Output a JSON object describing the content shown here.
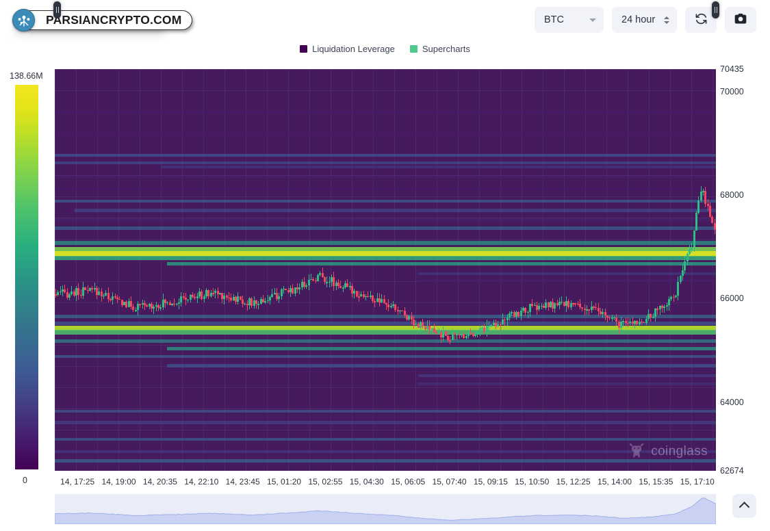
{
  "brand": {
    "name": "PARSIANCRYPTO.COM",
    "logo_icon": "parsian-crypto-logo-icon"
  },
  "toolbar": {
    "symbol_value": "BTC",
    "symbol_caret_icon": "chevron-down-icon",
    "range_value": "24 hour",
    "range_stepper_icon": "stepper-up-down-icon",
    "refresh_icon": "refresh-icon",
    "camera_icon": "camera-icon"
  },
  "legend": {
    "items": [
      {
        "label": "Liquidation Leverage",
        "color": "#440154"
      },
      {
        "label": "Supercharts",
        "color": "#4ec98b"
      }
    ]
  },
  "colorbar": {
    "max_label": "138.66M",
    "min_label": "0",
    "scheme": "viridis",
    "low_color": "#440154",
    "high_color": "#f2e620"
  },
  "watermark": {
    "text": "coinglass",
    "icon": "coinglass-bull-icon"
  },
  "navigator": {
    "left_handle_icon": "drag-handle-icon",
    "right_handle_icon": "drag-handle-icon",
    "area_color": "#c9d2f2"
  },
  "scroll_top": {
    "icon": "chevron-up-icon"
  },
  "chart_data": {
    "type": "heatmap",
    "title": "",
    "xlabel": "",
    "ylabel": "",
    "legend_position": "top-center",
    "grid": true,
    "ylim": [
      62674,
      70435
    ],
    "y_ticks": [
      "70435",
      "70000",
      "68000",
      "66000",
      "64000",
      "62674"
    ],
    "y_tick_values": [
      70435,
      70000,
      68000,
      66000,
      64000,
      62674
    ],
    "x_ticks": [
      "14, 17:25",
      "14, 19:00",
      "14, 20:35",
      "14, 22:10",
      "14, 23:45",
      "15, 01:20",
      "15, 02:55",
      "15, 04:30",
      "15, 06:05",
      "15, 07:40",
      "15, 09:15",
      "15, 10:50",
      "15, 12:25",
      "15, 14:00",
      "15, 15:35",
      "15, 17:10"
    ],
    "colorbar_range": [
      0,
      138660000
    ],
    "colorbar_max_label": "138.66M",
    "series": [
      {
        "name": "Liquidation Leverage",
        "color": "#440154"
      },
      {
        "name": "Supercharts",
        "color": "#4ec98b"
      }
    ],
    "liquidation_bands": [
      {
        "price": 69600,
        "x_start": 0.0,
        "x_end": 1.0,
        "intensity": 0.1
      },
      {
        "price": 69180,
        "x_start": 0.0,
        "x_end": 1.0,
        "intensity": 0.09
      },
      {
        "price": 68760,
        "x_start": 0.0,
        "x_end": 1.0,
        "intensity": 0.3
      },
      {
        "price": 68620,
        "x_start": 0.0,
        "x_end": 1.0,
        "intensity": 0.27
      },
      {
        "price": 68540,
        "x_start": 0.16,
        "x_end": 1.0,
        "intensity": 0.2
      },
      {
        "price": 68340,
        "x_start": 0.0,
        "x_end": 1.0,
        "intensity": 0.12
      },
      {
        "price": 68120,
        "x_start": 0.0,
        "x_end": 1.0,
        "intensity": 0.1
      },
      {
        "price": 67880,
        "x_start": 0.0,
        "x_end": 1.0,
        "intensity": 0.33
      },
      {
        "price": 67700,
        "x_start": 0.03,
        "x_end": 1.0,
        "intensity": 0.26
      },
      {
        "price": 67520,
        "x_start": 0.0,
        "x_end": 1.0,
        "intensity": 0.14
      },
      {
        "price": 67360,
        "x_start": 0.0,
        "x_end": 1.0,
        "intensity": 0.35
      },
      {
        "price": 67080,
        "x_start": 0.0,
        "x_end": 1.0,
        "intensity": 0.5
      },
      {
        "price": 66960,
        "x_start": 0.0,
        "x_end": 1.0,
        "intensity": 0.78
      },
      {
        "price": 66880,
        "x_start": 0.0,
        "x_end": 1.0,
        "intensity": 0.95
      },
      {
        "price": 66790,
        "x_start": 0.0,
        "x_end": 1.0,
        "intensity": 0.62
      },
      {
        "price": 66680,
        "x_start": 0.17,
        "x_end": 1.0,
        "intensity": 0.55
      },
      {
        "price": 66480,
        "x_start": 0.55,
        "x_end": 1.0,
        "intensity": 0.2
      },
      {
        "price": 66340,
        "x_start": 0.55,
        "x_end": 1.0,
        "intensity": 0.12
      },
      {
        "price": 65650,
        "x_start": 0.0,
        "x_end": 1.0,
        "intensity": 0.38
      },
      {
        "price": 65520,
        "x_start": 0.0,
        "x_end": 1.0,
        "intensity": 0.3
      },
      {
        "price": 65440,
        "x_start": 0.0,
        "x_end": 1.0,
        "intensity": 0.88
      },
      {
        "price": 65360,
        "x_start": 0.0,
        "x_end": 1.0,
        "intensity": 0.7
      },
      {
        "price": 65180,
        "x_start": 0.0,
        "x_end": 1.0,
        "intensity": 0.45
      },
      {
        "price": 65040,
        "x_start": 0.17,
        "x_end": 1.0,
        "intensity": 0.52
      },
      {
        "price": 64880,
        "x_start": 0.0,
        "x_end": 1.0,
        "intensity": 0.34
      },
      {
        "price": 64700,
        "x_start": 0.17,
        "x_end": 1.0,
        "intensity": 0.3
      },
      {
        "price": 64500,
        "x_start": 0.55,
        "x_end": 1.0,
        "intensity": 0.22
      },
      {
        "price": 64340,
        "x_start": 0.55,
        "x_end": 1.0,
        "intensity": 0.18
      },
      {
        "price": 63820,
        "x_start": 0.0,
        "x_end": 1.0,
        "intensity": 0.3
      },
      {
        "price": 63600,
        "x_start": 0.0,
        "x_end": 1.0,
        "intensity": 0.24
      },
      {
        "price": 63280,
        "x_start": 0.0,
        "x_end": 1.0,
        "intensity": 0.32
      },
      {
        "price": 63040,
        "x_start": 0.0,
        "x_end": 1.0,
        "intensity": 0.2
      },
      {
        "price": 62860,
        "x_start": 0.0,
        "x_end": 1.0,
        "intensity": 0.36
      }
    ],
    "price_note": "BTC/USD candlesticks overlaid; open near 66050, dips to ~65100 mid-session, spikes to ~68200 at the right edge"
  }
}
